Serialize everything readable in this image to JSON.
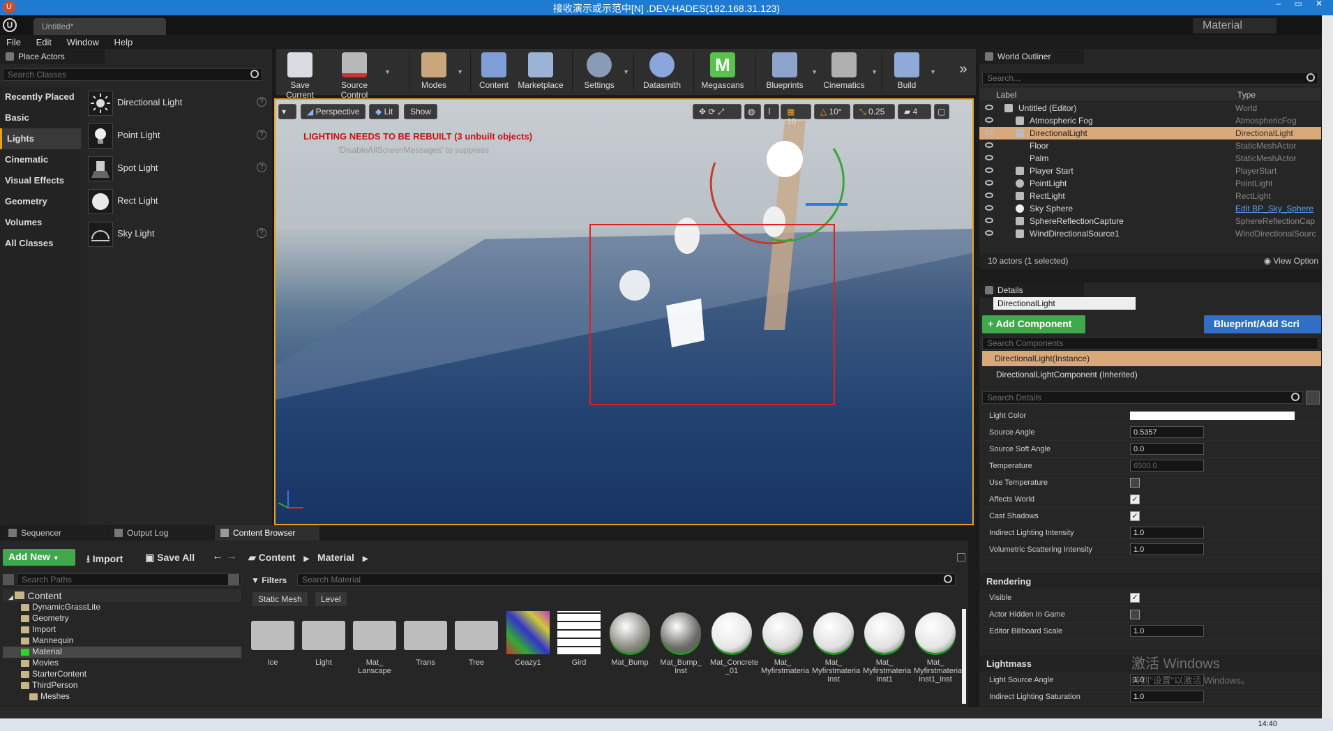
{
  "window": {
    "title": "接收演示或示范中[N] .DEV-HADES(192.168.31.123)",
    "doc_tab": "Untitled*",
    "mode_badge": "Material"
  },
  "menu": [
    "File",
    "Edit",
    "Window",
    "Help"
  ],
  "place_actors": {
    "tab": "Place Actors",
    "search_placeholder": "Search Classes",
    "categories": [
      "Recently Placed",
      "Basic",
      "Lights",
      "Cinematic",
      "Visual Effects",
      "Geometry",
      "Volumes",
      "All Classes"
    ],
    "selected_category": "Lights",
    "items": [
      "Directional Light",
      "Point Light",
      "Spot Light",
      "Rect Light",
      "Sky Light"
    ]
  },
  "toolbar": [
    "Save Current",
    "Source Control",
    "Modes",
    "Content",
    "Marketplace",
    "Settings",
    "Datasmith",
    "Megascans",
    "Blueprints",
    "Cinematics",
    "Build"
  ],
  "viewport": {
    "perspective": "Perspective",
    "lit": "Lit",
    "show": "Show",
    "snap_grid": "10",
    "snap_angle": "10°",
    "snap_scale": "0.25",
    "cam_speed": "4",
    "warning": "LIGHTING NEEDS TO BE REBUILT (3 unbuilt objects)",
    "suppress": "'DisableAllScreenMessages' to suppress"
  },
  "outliner": {
    "tab": "World Outliner",
    "search_placeholder": "Search...",
    "col_label": "Label",
    "col_type": "Type",
    "rows": [
      {
        "label": "Untitled (Editor)",
        "type": "World"
      },
      {
        "label": "Atmospheric Fog",
        "type": "AtmosphericFog"
      },
      {
        "label": "DirectionalLight",
        "type": "DirectionalLight"
      },
      {
        "label": "Floor",
        "type": "StaticMeshActor"
      },
      {
        "label": "Palm",
        "type": "StaticMeshActor"
      },
      {
        "label": "Player Start",
        "type": "PlayerStart"
      },
      {
        "label": "PointLight",
        "type": "PointLight"
      },
      {
        "label": "RectLight",
        "type": "RectLight"
      },
      {
        "label": "Sky Sphere",
        "type": "Edit BP_Sky_Sphere"
      },
      {
        "label": "SphereReflectionCapture",
        "type": "SphereReflectionCap"
      },
      {
        "label": "WindDirectionalSource1",
        "type": "WindDirectionalSourc"
      }
    ],
    "status": "10 actors (1 selected)",
    "view_options": "View Option"
  },
  "details": {
    "tab": "Details",
    "name": "DirectionalLight",
    "add_component": "+ Add Component",
    "blueprint": "Blueprint/Add Scri",
    "search_components": "Search Components",
    "instance": "DirectionalLight(Instance)",
    "component": "DirectionalLightComponent (Inherited)",
    "search_details": "Search Details",
    "props": [
      {
        "label": "Light Color",
        "kind": "color"
      },
      {
        "label": "Source Angle",
        "kind": "num",
        "value": "0.5357"
      },
      {
        "label": "Source Soft Angle",
        "kind": "num",
        "value": "0.0"
      },
      {
        "label": "Temperature",
        "kind": "numdim",
        "value": "6500.0"
      },
      {
        "label": "Use Temperature",
        "kind": "off"
      },
      {
        "label": "Affects World",
        "kind": "on"
      },
      {
        "label": "Cast Shadows",
        "kind": "on"
      },
      {
        "label": "Indirect Lighting Intensity",
        "kind": "num",
        "value": "1.0"
      },
      {
        "label": "Volumetric Scattering Intensity",
        "kind": "num",
        "value": "1.0"
      }
    ],
    "rendering_title": "Rendering",
    "rendering": [
      {
        "label": "Visible",
        "kind": "on"
      },
      {
        "label": "Actor Hidden In Game",
        "kind": "off"
      },
      {
        "label": "Editor Billboard Scale",
        "kind": "num",
        "value": "1.0"
      }
    ],
    "lightmass_title": "Lightmass",
    "lightmass": [
      {
        "label": "Light Source Angle",
        "kind": "num",
        "value": "1.0"
      },
      {
        "label": "Indirect Lighting Saturation",
        "kind": "num",
        "value": "1.0"
      }
    ],
    "watermark1": "激活 Windows",
    "watermark2": "转到\"设置\"以激活 Windows。"
  },
  "bottom_tabs": [
    "Sequencer",
    "Output Log",
    "Content Browser"
  ],
  "content_browser": {
    "add_new": "Add New",
    "import": "Import",
    "save_all": "Save All",
    "path": [
      "Content",
      "Material"
    ],
    "search_paths": "Search Paths",
    "filters": "Filters",
    "search_material": "Search Material",
    "filter_chips": [
      "Static Mesh",
      "Level"
    ],
    "tree_root": "Content",
    "tree": [
      "DynamicGrassLite",
      "Geometry",
      "Import",
      "Mannequin",
      "Material",
      "Movies",
      "StarterContent",
      "ThirdPerson",
      "Meshes"
    ],
    "assets": [
      {
        "name": "Ice",
        "kind": "folder"
      },
      {
        "name": "Light",
        "kind": "folder"
      },
      {
        "name": "Mat_ Lanscape",
        "kind": "folder"
      },
      {
        "name": "Trans",
        "kind": "folder"
      },
      {
        "name": "Tree",
        "kind": "folder"
      },
      {
        "name": "Ceazy1",
        "kind": "noise"
      },
      {
        "name": "Gird",
        "kind": "brick"
      },
      {
        "name": "Mat_Bump",
        "kind": "sphere",
        "color": "#8a8a82"
      },
      {
        "name": "Mat_Bump_ Inst",
        "kind": "sphere",
        "color": "#6c6c66"
      },
      {
        "name": "Mat_Concrete _01",
        "kind": "sphere",
        "color": "#e7e7e7"
      },
      {
        "name": "Mat_ Myfirstmateria",
        "kind": "sphere",
        "color": "#dcdcdc"
      },
      {
        "name": "Mat_ Myfirstmateria Inst",
        "kind": "sphere",
        "color": "#e0e0e0"
      },
      {
        "name": "Mat_ Myfirstmateria Inst1",
        "kind": "sphere",
        "color": "#e2e2e2"
      },
      {
        "name": "Mat_ Myfirstmateria Inst1_Inst",
        "kind": "sphere",
        "color": "#e4e4e4"
      }
    ]
  },
  "taskbar_clock": "14:40"
}
